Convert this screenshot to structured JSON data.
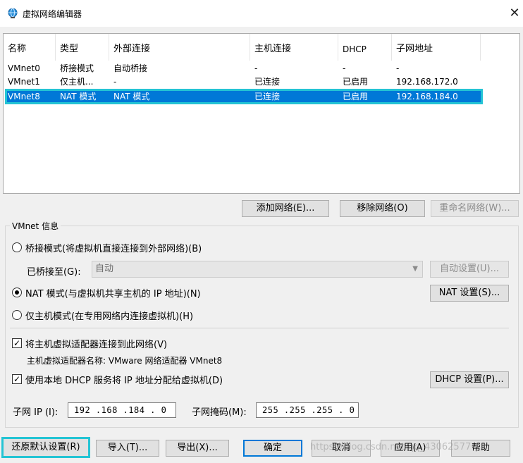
{
  "window": {
    "title": "虚拟网络编辑器",
    "icon": "globe-network-icon",
    "close": "✕"
  },
  "list": {
    "columns": [
      "名称",
      "类型",
      "外部连接",
      "主机连接",
      "DHCP",
      "子网地址"
    ],
    "rows": [
      {
        "name": "VMnet0",
        "type": "桥接模式",
        "external": "自动桥接",
        "host": "-",
        "dhcp": "-",
        "subnet": "-"
      },
      {
        "name": "VMnet1",
        "type": "仅主机...",
        "external": "-",
        "host": "已连接",
        "dhcp": "已启用",
        "subnet": "192.168.172.0"
      },
      {
        "name": "VMnet8",
        "type": "NAT 模式",
        "external": "NAT 模式",
        "host": "已连接",
        "dhcp": "已启用",
        "subnet": "192.168.184.0"
      }
    ],
    "selected_index": 2
  },
  "list_buttons": {
    "add": "添加网络(E)...",
    "remove": "移除网络(O)",
    "rename": "重命名网络(W)..."
  },
  "vmnet_info": {
    "legend": "VMnet 信息",
    "bridge_radio": "桥接模式(将虚拟机直接连接到外部网络)(B)",
    "bridged_to_label": "已桥接至(G):",
    "bridged_to_value": "自动",
    "auto_settings": "自动设置(U)...",
    "nat_radio": "NAT 模式(与虚拟机共享主机的 IP 地址)(N)",
    "nat_settings": "NAT 设置(S)...",
    "hostonly_radio": "仅主机模式(在专用网络内连接虚拟机)(H)",
    "connect_adapter_check": "将主机虚拟适配器连接到此网络(V)",
    "adapter_name_line": "主机虚拟适配器名称: VMware 网络适配器 VMnet8",
    "dhcp_check": "使用本地 DHCP 服务将 IP 地址分配给虚拟机(D)",
    "dhcp_settings": "DHCP 设置(P)...",
    "subnet_ip_label": "子网 IP (I):",
    "subnet_ip_value": "192 .168 .184 . 0",
    "subnet_mask_label": "子网掩码(M):",
    "subnet_mask_value": "255 .255 .255 . 0",
    "selected_mode": "nat",
    "connect_adapter_checked": true,
    "dhcp_checked": true
  },
  "bottom_buttons": {
    "restore": "还原默认设置(R)",
    "import": "导入(T)...",
    "export": "导出(X)...",
    "ok": "确定",
    "cancel": "取消",
    "apply": "应用(A)",
    "help": "帮助"
  },
  "watermark": "https://blog.csdn.net/qq_43062577",
  "colors": {
    "selection": "#0078d7",
    "highlight_outline": "#24c4d4",
    "default_button_border": "#0078d7"
  }
}
